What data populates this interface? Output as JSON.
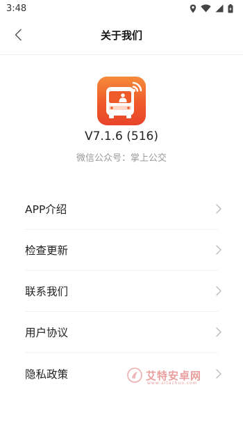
{
  "status_bar": {
    "time": "3:48",
    "icons": [
      "location-icon",
      "wifi-icon",
      "signal-icon",
      "battery-icon"
    ]
  },
  "header": {
    "title": "关于我们",
    "back_icon": "chevron-left-icon"
  },
  "app": {
    "icon": "bus-app-icon",
    "version": "V7.1.6 (516)",
    "wechat": "微信公众号：掌上公交"
  },
  "menu": {
    "items": [
      {
        "label": "APP介绍"
      },
      {
        "label": "检查更新"
      },
      {
        "label": "联系我们"
      },
      {
        "label": "用户协议"
      },
      {
        "label": "隐私政策"
      }
    ]
  },
  "watermark": {
    "text": "艾特安卓网",
    "sub": "www.aitazhuo.com"
  },
  "colors": {
    "icon_gradient_top": "#f58a3a",
    "icon_gradient_bottom": "#e8442a",
    "chevron": "#b8b8b8",
    "secondary_text": "#999999"
  }
}
